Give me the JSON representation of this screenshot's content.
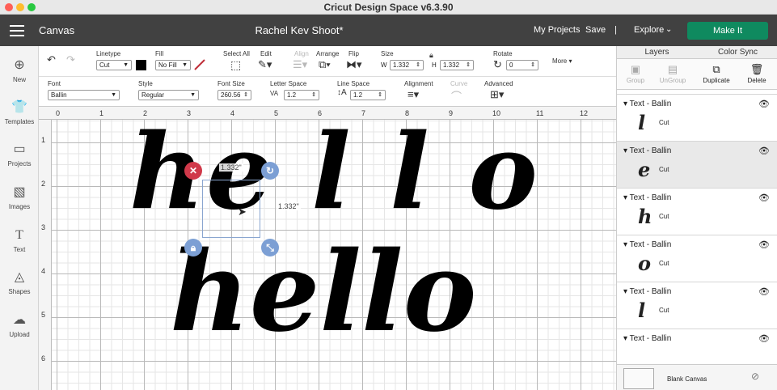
{
  "window": {
    "title": "Cricut Design Space  v6.3.90"
  },
  "header": {
    "section": "Canvas",
    "project_name": "Rachel Kev Shoot*",
    "my_projects": "My Projects",
    "save": "Save",
    "divider": "|",
    "explore": "Explore",
    "make_it": "Make It",
    "accent_color": "#0f8a5f"
  },
  "sidebar": {
    "items": [
      {
        "label": "New",
        "icon": "plus-circle-icon"
      },
      {
        "label": "Templates",
        "icon": "shirt-icon"
      },
      {
        "label": "Projects",
        "icon": "bookmark-icon"
      },
      {
        "label": "Images",
        "icon": "image-icon"
      },
      {
        "label": "Text",
        "icon": "text-icon"
      },
      {
        "label": "Shapes",
        "icon": "shapes-icon"
      },
      {
        "label": "Upload",
        "icon": "upload-icon"
      }
    ]
  },
  "toolbar": {
    "linetype_label": "Linetype",
    "linetype_value": "Cut",
    "fill_label": "Fill",
    "fill_value": "No Fill",
    "select_all": "Select All",
    "edit": "Edit",
    "align": "Align",
    "arrange": "Arrange",
    "flip": "Flip",
    "size_label": "Size",
    "w_label": "W",
    "w_value": "1.332",
    "h_label": "H",
    "h_value": "1.332",
    "rotate_label": "Rotate",
    "rotate_value": "0",
    "more": "More",
    "font_label": "Font",
    "font_value": "Ballin",
    "style_label": "Style",
    "style_value": "Regular",
    "font_size_label": "Font Size",
    "font_size_value": "260.56",
    "letter_space_label": "Letter Space",
    "letter_space_value": "1.2",
    "line_space_label": "Line Space",
    "line_space_value": "1.2",
    "alignment_label": "Alignment",
    "curve_label": "Curve",
    "advanced_label": "Advanced"
  },
  "rulers": {
    "top": [
      "0",
      "1",
      "2",
      "3",
      "4",
      "5",
      "6",
      "7",
      "8",
      "9",
      "10",
      "11",
      "12"
    ],
    "left": [
      "1",
      "2",
      "3",
      "4",
      "5",
      "6"
    ]
  },
  "canvas": {
    "word1": "he l l o",
    "word2": "hello",
    "sel_width": "1.332\"",
    "sel_height": "1.332\""
  },
  "panel": {
    "tab_layers": "Layers",
    "tab_color_sync": "Color Sync",
    "actions": [
      "Group",
      "UnGroup",
      "Duplicate",
      "Delete"
    ],
    "layers": [
      {
        "name": "Text - Ballin",
        "glyph": "l",
        "op": "Cut",
        "active": false
      },
      {
        "name": "Text - Ballin",
        "glyph": "e",
        "op": "Cut",
        "active": true
      },
      {
        "name": "Text - Ballin",
        "glyph": "h",
        "op": "Cut",
        "active": false
      },
      {
        "name": "Text - Ballin",
        "glyph": "o",
        "op": "Cut",
        "active": false
      },
      {
        "name": "Text - Ballin",
        "glyph": "l",
        "op": "Cut",
        "active": false
      },
      {
        "name": "Text - Ballin",
        "glyph": "",
        "op": "",
        "active": false
      }
    ],
    "blank_canvas": "Blank Canvas"
  }
}
